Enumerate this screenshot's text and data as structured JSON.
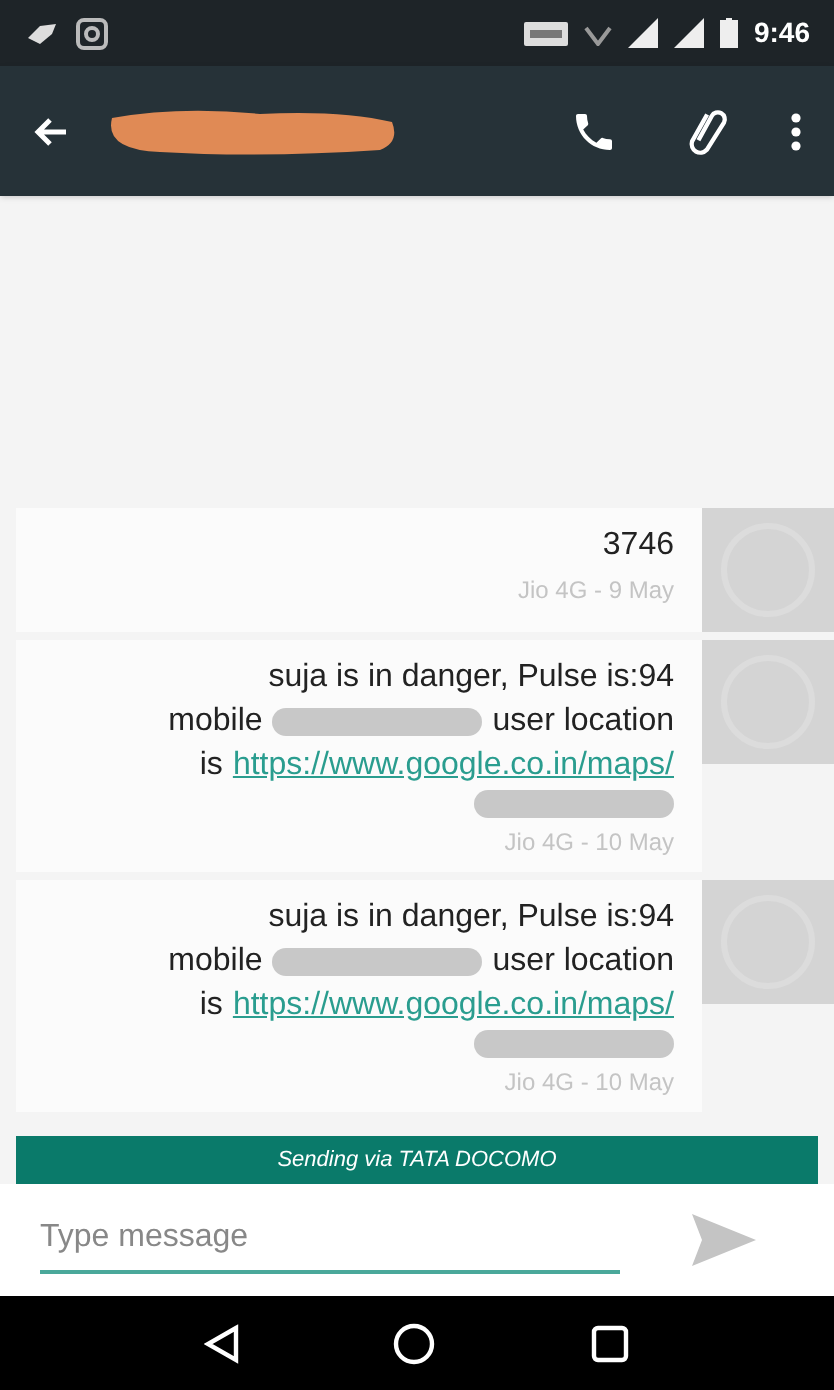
{
  "status_bar": {
    "time": "9:46"
  },
  "toolbar": {
    "contact_redacted": true
  },
  "messages": [
    {
      "lines": [
        [
          {
            "kind": "text",
            "text": "3746"
          }
        ]
      ],
      "meta": "Jio 4G - 9 May"
    },
    {
      "lines": [
        [
          {
            "kind": "text",
            "text": "suja is in danger, Pulse is:94"
          }
        ],
        [
          {
            "kind": "text",
            "text": "mobile"
          },
          {
            "kind": "redacted"
          },
          {
            "kind": "text",
            "text": "user location"
          }
        ],
        [
          {
            "kind": "text",
            "text": "is"
          },
          {
            "kind": "link",
            "text": "https://www.google.co.in/maps/"
          }
        ],
        [
          {
            "kind": "redacted"
          }
        ]
      ],
      "meta": "Jio 4G - 10 May"
    },
    {
      "lines": [
        [
          {
            "kind": "text",
            "text": "suja is in danger, Pulse is:94"
          }
        ],
        [
          {
            "kind": "text",
            "text": "mobile"
          },
          {
            "kind": "redacted"
          },
          {
            "kind": "text",
            "text": "user location"
          }
        ],
        [
          {
            "kind": "text",
            "text": "is"
          },
          {
            "kind": "link",
            "text": "https://www.google.co.in/maps/"
          }
        ],
        [
          {
            "kind": "redacted"
          }
        ]
      ],
      "meta": "Jio 4G - 10 May"
    }
  ],
  "sending_banner": "Sending via TATA DOCOMO",
  "composer": {
    "placeholder": "Type message"
  }
}
